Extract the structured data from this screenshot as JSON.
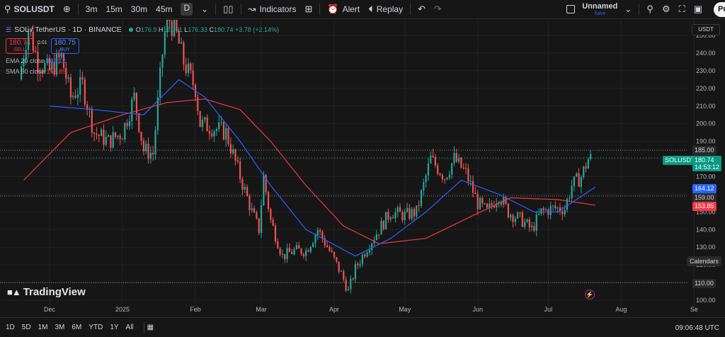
{
  "toolbar": {
    "symbol": "SOLUSDT",
    "intervals": [
      "3m",
      "15m",
      "30m",
      "45m",
      "D"
    ],
    "active_interval": "D",
    "indicators_label": "Indicators",
    "alert_label": "Alert",
    "replay_label": "Replay",
    "layout_name": "Unnamed",
    "layout_status": "Save",
    "publish_label": "Pu"
  },
  "legend": {
    "title": "SOL / TetherUS · 1D · BINANCE",
    "open_label": "O",
    "open": "176.9",
    "high_label": "H",
    "high": "181.51",
    "low_label": "L",
    "low": "176.33",
    "close_label": "C",
    "close": "180.74",
    "change": "+3.78 (+2.14%)",
    "sell_price": "180.74",
    "sell_label": "SELL",
    "spread": "0.01",
    "buy_price": "180.75",
    "buy_label": "BUY",
    "ema_label": "EMA 20 close",
    "ema_value": "164.12",
    "sma_label": "SMA 50 close",
    "sma_value": "153.85"
  },
  "watermark": "TradingView",
  "currency": "USDT",
  "calendars_label": "Calendars",
  "price_tags": {
    "resistance": "185.00",
    "symbol": "SOLUSDT",
    "last": "180.74",
    "countdown": "14:53:12",
    "ema": "164.12",
    "mid": "159.00",
    "sma": "153.85",
    "support": "110.00"
  },
  "bottom": {
    "ranges": [
      "1D",
      "5D",
      "1M",
      "3M",
      "6M",
      "YTD",
      "1Y",
      "All"
    ],
    "time": "09:06:48 UTC"
  },
  "colors": {
    "up": "#26a69a",
    "down": "#ef5350",
    "ema": "#2962ff",
    "sma": "#f23645"
  },
  "chart_data": {
    "type": "candlestick",
    "title": "SOL / TetherUS · 1D · BINANCE",
    "y_range": [
      100,
      255
    ],
    "y_ticks": [
      100,
      110,
      120,
      130,
      140,
      150,
      160,
      170,
      180,
      190,
      200,
      210,
      220,
      230,
      240,
      250
    ],
    "x_ticks": [
      "Dec",
      "2025",
      "Feb",
      "Mar",
      "Apr",
      "May",
      "Jun",
      "Jul",
      "Aug",
      "Se"
    ],
    "horizontal_levels": [
      185,
      159,
      110
    ],
    "close_path": [
      [
        "2024-11-18",
        225
      ],
      [
        "2024-11-22",
        255
      ],
      [
        "2024-11-26",
        235
      ],
      [
        "2024-12-01",
        230
      ],
      [
        "2024-12-06",
        238
      ],
      [
        "2024-12-10",
        215
      ],
      [
        "2024-12-15",
        222
      ],
      [
        "2024-12-20",
        195
      ],
      [
        "2024-12-26",
        190
      ],
      [
        "2025-01-01",
        195
      ],
      [
        "2025-01-06",
        215
      ],
      [
        "2025-01-10",
        185
      ],
      [
        "2025-01-14",
        183
      ],
      [
        "2025-01-18",
        240
      ],
      [
        "2025-01-20",
        262
      ],
      [
        "2025-01-24",
        250
      ],
      [
        "2025-01-27",
        235
      ],
      [
        "2025-02-01",
        220
      ],
      [
        "2025-02-03",
        200
      ],
      [
        "2025-02-08",
        198
      ],
      [
        "2025-02-14",
        195
      ],
      [
        "2025-02-20",
        170
      ],
      [
        "2025-02-25",
        150
      ],
      [
        "2025-02-28",
        140
      ],
      [
        "2025-03-02",
        170
      ],
      [
        "2025-03-05",
        145
      ],
      [
        "2025-03-10",
        125
      ],
      [
        "2025-03-15",
        128
      ],
      [
        "2025-03-20",
        128
      ],
      [
        "2025-03-25",
        140
      ],
      [
        "2025-03-30",
        128
      ],
      [
        "2025-04-04",
        115
      ],
      [
        "2025-04-07",
        105
      ],
      [
        "2025-04-10",
        118
      ],
      [
        "2025-04-15",
        130
      ],
      [
        "2025-04-20",
        140
      ],
      [
        "2025-04-25",
        150
      ],
      [
        "2025-05-01",
        148
      ],
      [
        "2025-05-06",
        150
      ],
      [
        "2025-05-12",
        180
      ],
      [
        "2025-05-18",
        170
      ],
      [
        "2025-05-22",
        180
      ],
      [
        "2025-05-27",
        172
      ],
      [
        "2025-06-01",
        155
      ],
      [
        "2025-06-05",
        150
      ],
      [
        "2025-06-10",
        160
      ],
      [
        "2025-06-14",
        150
      ],
      [
        "2025-06-20",
        145
      ],
      [
        "2025-06-24",
        140
      ],
      [
        "2025-06-28",
        150
      ],
      [
        "2025-07-03",
        152
      ],
      [
        "2025-07-08",
        152
      ],
      [
        "2025-07-11",
        165
      ],
      [
        "2025-07-15",
        170
      ],
      [
        "2025-07-18",
        180
      ],
      [
        "2025-07-21",
        180.74
      ]
    ],
    "ema20_path": [
      [
        "2024-12-01",
        210
      ],
      [
        "2024-12-20",
        208
      ],
      [
        "2025-01-10",
        205
      ],
      [
        "2025-01-25",
        225
      ],
      [
        "2025-02-05",
        215
      ],
      [
        "2025-02-20",
        190
      ],
      [
        "2025-03-05",
        165
      ],
      [
        "2025-03-20",
        140
      ],
      [
        "2025-04-10",
        125
      ],
      [
        "2025-04-25",
        135
      ],
      [
        "2025-05-10",
        150
      ],
      [
        "2025-05-25",
        168
      ],
      [
        "2025-06-10",
        160
      ],
      [
        "2025-06-25",
        150
      ],
      [
        "2025-07-05",
        150
      ],
      [
        "2025-07-21",
        164.12
      ]
    ],
    "sma50_path": [
      [
        "2024-11-20",
        168
      ],
      [
        "2024-12-10",
        195
      ],
      [
        "2025-01-01",
        205
      ],
      [
        "2025-01-20",
        212
      ],
      [
        "2025-02-05",
        214
      ],
      [
        "2025-02-20",
        208
      ],
      [
        "2025-03-05",
        190
      ],
      [
        "2025-03-20",
        165
      ],
      [
        "2025-04-05",
        142
      ],
      [
        "2025-04-20",
        132
      ],
      [
        "2025-05-10",
        135
      ],
      [
        "2025-05-30",
        148
      ],
      [
        "2025-06-15",
        158
      ],
      [
        "2025-07-05",
        157
      ],
      [
        "2025-07-21",
        153.85
      ]
    ]
  }
}
